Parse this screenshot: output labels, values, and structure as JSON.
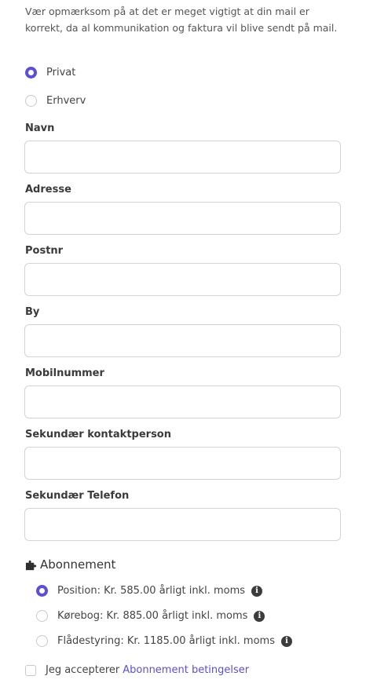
{
  "notice": "Vær opmærksom på at det er meget vigtigt at din mail er korrekt, da al kommunikation og faktura vil blive sendt på mail.",
  "customer_type": {
    "options": [
      {
        "label": "Privat",
        "selected": true
      },
      {
        "label": "Erhverv",
        "selected": false
      }
    ]
  },
  "fields": {
    "navn": {
      "label": "Navn",
      "value": ""
    },
    "adresse": {
      "label": "Adresse",
      "value": ""
    },
    "postnr": {
      "label": "Postnr",
      "value": ""
    },
    "by": {
      "label": "By",
      "value": ""
    },
    "mobilnummer": {
      "label": "Mobilnummer",
      "value": ""
    },
    "sekundaer_kontakt": {
      "label": "Sekundær kontaktperson",
      "value": ""
    },
    "sekundaer_telefon": {
      "label": "Sekundær Telefon",
      "value": ""
    }
  },
  "subscription": {
    "title": "Abonnement",
    "icon": "puzzle-icon",
    "options": [
      {
        "label": "Position: Kr. 585.00 årligt inkl. moms",
        "selected": true
      },
      {
        "label": "Kørebog: Kr. 885.00 årligt inkl. moms",
        "selected": false
      },
      {
        "label": "Flådestyring: Kr. 1185.00 årligt inkl. moms",
        "selected": false
      }
    ],
    "info_glyph": "i"
  },
  "terms": {
    "checked": false,
    "text": "Jeg accepterer",
    "link_text": "Abonnement betingelser"
  },
  "colors": {
    "accent": "#5b4fd6",
    "border": "#d4d4d4",
    "info_icon": "#3c3c3c"
  }
}
